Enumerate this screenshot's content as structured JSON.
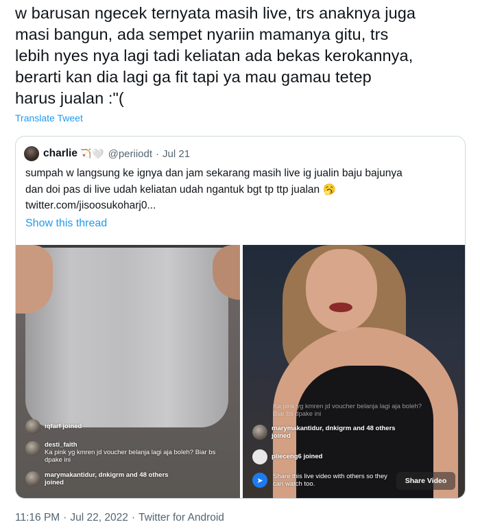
{
  "tweet": {
    "lines": [
      "w barusan ngecek ternyata masih live, trs anaknya juga",
      "masi bangun, ada sempet nyariin mamanya gitu, trs",
      "lebih nyes nya lagi tadi keliatan ada bekas kerokannya,",
      "berarti kan dia lagi ga fit tapi ya mau gamau tetep",
      "harus jualan :\"("
    ],
    "translate_label": "Translate Tweet"
  },
  "quote": {
    "name": "charlie",
    "name_emoji": "🏹",
    "name_emoji2": "🤍",
    "handle": "@periiodt",
    "separator": "·",
    "date": "Jul 21",
    "body_lines": [
      "sumpah w langsung ke ignya dan jam sekarang masih live ig jualin baju bajunya",
      "dan doi pas di live udah keliatan udah ngantuk bgt tp ttp jualan 🥱",
      "twitter.com/jisoosukoharj0..."
    ],
    "show_thread_label": "Show this thread"
  },
  "media_left": {
    "comments": [
      {
        "user": "iqfarf joined",
        "text": ""
      },
      {
        "user": "desti_faith",
        "text": "Ka pink yg kmren jd voucher belanja lagi aja boleh? Biar bs dpake ini"
      },
      {
        "user": "marymakantidur, dnkigrm and 48 others joined",
        "text": ""
      }
    ]
  },
  "media_right": {
    "faded_comment": "Ka pink yg kmren jd voucher belanja lagi aja boleh? Biar bs dpake ini",
    "joined_text": "marymakantidur, dnkigrm and 48 others joined",
    "joined2": "plieceng6 joined",
    "share_text": "Share this live video with others so they can watch too.",
    "share_button": "Share Video"
  },
  "footer": {
    "time": "11:16 PM",
    "sep": "·",
    "date": "Jul 22, 2022",
    "source": "Twitter for Android"
  },
  "colors": {
    "link": "#1d9bf0",
    "text": "#0f1419",
    "muted": "#536471",
    "border": "#cfd9de"
  }
}
